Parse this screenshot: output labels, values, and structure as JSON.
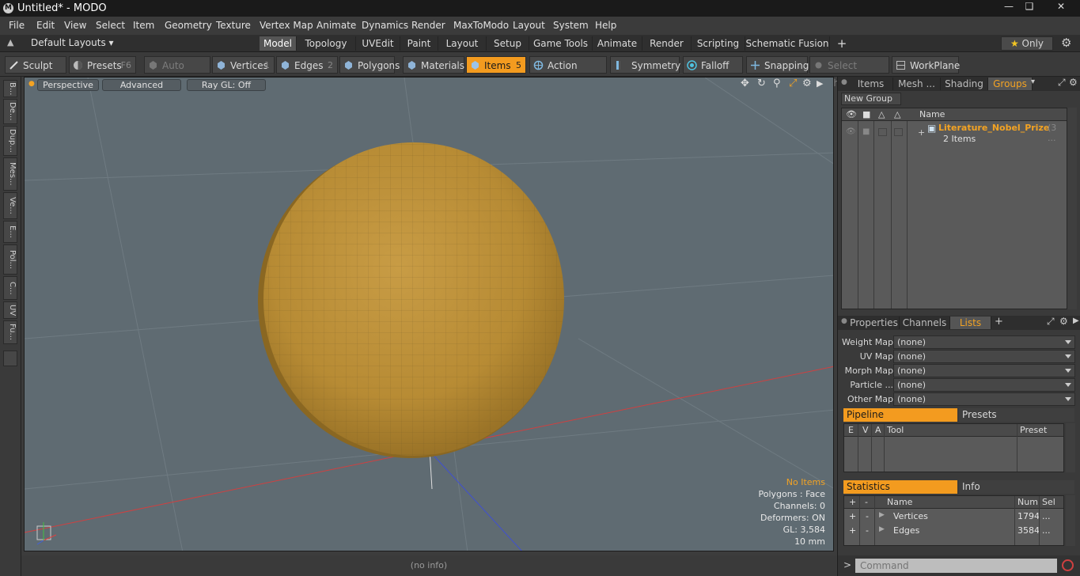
{
  "window": {
    "title": "Untitled* - MODO",
    "logo": "M"
  },
  "menu": [
    "File",
    "Edit",
    "View",
    "Select",
    "Item",
    "Geometry",
    "Texture",
    "Vertex Map",
    "Animate",
    "Dynamics",
    "Render",
    "MaxToModo",
    "Layout",
    "System",
    "Help"
  ],
  "layouts": {
    "dropdown": "Default Layouts",
    "tabs": [
      "Model",
      "Topology",
      "UVEdit",
      "Paint",
      "Layout",
      "Setup",
      "Game Tools",
      "Animate",
      "Render",
      "Scripting",
      "Schematic Fusion"
    ],
    "active": "Model",
    "add": "+",
    "only": "Only"
  },
  "toolbar": {
    "sculpt": "Sculpt",
    "presets": "Presets",
    "presets_key": "F6",
    "auto_select": "Auto Select",
    "vertices": "Vertices",
    "vertices_key": "1",
    "edges": "Edges",
    "edges_key": "2",
    "polygons": "Polygons",
    "materials": "Materials",
    "items": "Items",
    "items_key": "5",
    "action_center": "Action Center",
    "symmetry": "Symmetry",
    "falloff": "Falloff",
    "snapping": "Snapping",
    "select_through": "Select Through",
    "workplane": "WorkPlane"
  },
  "left_tabs": [
    "B...",
    "De...",
    "Dup...",
    "Mes...",
    "Ve...",
    "E...",
    "Pol...",
    "C...",
    "UV",
    "Fu..."
  ],
  "viewport": {
    "view": "Perspective",
    "shading": "Advanced",
    "raygl": "Ray GL: Off",
    "status": {
      "items": "No Items",
      "polygons": "Polygons : Face",
      "channels": "Channels: 0",
      "deformers": "Deformers: ON",
      "gl": "GL: 3,584",
      "scale": "10 mm"
    }
  },
  "info_bar": "(no info)",
  "groups_panel": {
    "tabs": [
      "Items",
      "Mesh ...",
      "Shading",
      "Groups"
    ],
    "active": "Groups",
    "new_group": "New Group",
    "col_name": "Name",
    "group_name": "Literature_Nobel_Prize",
    "group_count": "(3 ...",
    "group_items": "2 Items"
  },
  "props_panel": {
    "tabs": [
      "Properties",
      "Channels",
      "Lists"
    ],
    "active": "Lists",
    "add": "+",
    "rows": [
      {
        "label": "Weight Map",
        "value": "(none)"
      },
      {
        "label": "UV Map",
        "value": "(none)"
      },
      {
        "label": "Morph Map",
        "value": "(none)"
      },
      {
        "label": "Particle ...",
        "value": "(none)"
      },
      {
        "label": "Other Map",
        "value": "(none)"
      }
    ],
    "pipeline": "Pipeline",
    "presets": "Presets",
    "pipeline_cols": {
      "e": "E",
      "v": "V",
      "a": "A",
      "tool": "Tool",
      "preset": "Preset"
    },
    "statistics": "Statistics",
    "info": "Info",
    "stat_cols": {
      "plus": "+",
      "minus": "-",
      "name": "Name",
      "num": "Num",
      "sel": "Sel"
    },
    "stat_rows": [
      {
        "plus": "+",
        "minus": "-",
        "name": "Vertices",
        "num": "1794",
        "sel": "..."
      },
      {
        "plus": "+",
        "minus": "-",
        "name": "Edges",
        "num": "3584",
        "sel": "..."
      }
    ]
  },
  "command": {
    "placeholder": "Command",
    "prompt": ">"
  }
}
